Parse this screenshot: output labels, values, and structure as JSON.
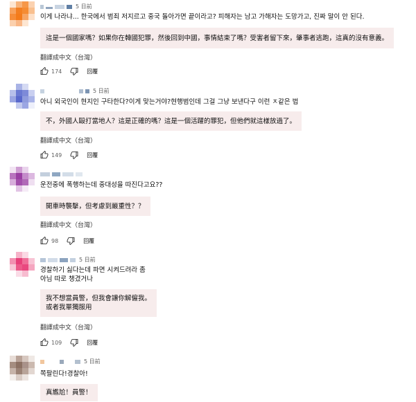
{
  "translate_label": "翻譯成中文（台灣）",
  "reply_label": "回覆",
  "comments": [
    {
      "time": "5 日前",
      "text_lines": [
        "이게 나라냐... 한국에서 범죄 저지르고 중국 돌아가면 끝이라고? 피해자는 남고 가해자는 도망가고, 진짜 말이 안 된다."
      ],
      "translation_lines": [
        "這是一個國家嗎？如果你在韓國犯罪，然後回到中國，事情結束了嗎？受害者留下來，肇事者逃跑，這真的沒有意義。"
      ],
      "likes": "174"
    },
    {
      "time": "5 日前",
      "text_lines": [
        "아니 외국인이 현지인 구타한다?이게 맞는거야?현행범인데 그걸 그냥 보낸다구 이런 ㅈ같은 법"
      ],
      "translation_lines": [
        "不，外國人毆打當地人？這是正確的嗎？這是一個活躍的罪犯，但他們就這樣放過了。"
      ],
      "likes": "149"
    },
    {
      "time": "",
      "text_lines": [
        "운전중에 폭행하는데 중대성을 따진다고요??"
      ],
      "translation_lines": [
        "開車時襲擊，但考慮到嚴重性？？"
      ],
      "likes": "98"
    },
    {
      "time": "5 日前",
      "text_lines": [
        "경찰하기 싫다는데 파면 시켜드려라 좀",
        "아님 따로 챙겼거나"
      ],
      "translation_lines": [
        "我不想當員警，但我會讓你解僱我。",
        "或者我單獨服用"
      ],
      "likes": "109"
    },
    {
      "time": "5 日前",
      "text_lines": [
        "쪽팔린다!경찰아!"
      ],
      "translation_lines": [
        "真尷尬！員警！"
      ],
      "likes": ""
    }
  ],
  "colors": {
    "translation_bg": "#f7ecec",
    "muted_text": "#606060"
  },
  "icons": [
    "thumb-up-icon",
    "thumb-down-icon"
  ]
}
